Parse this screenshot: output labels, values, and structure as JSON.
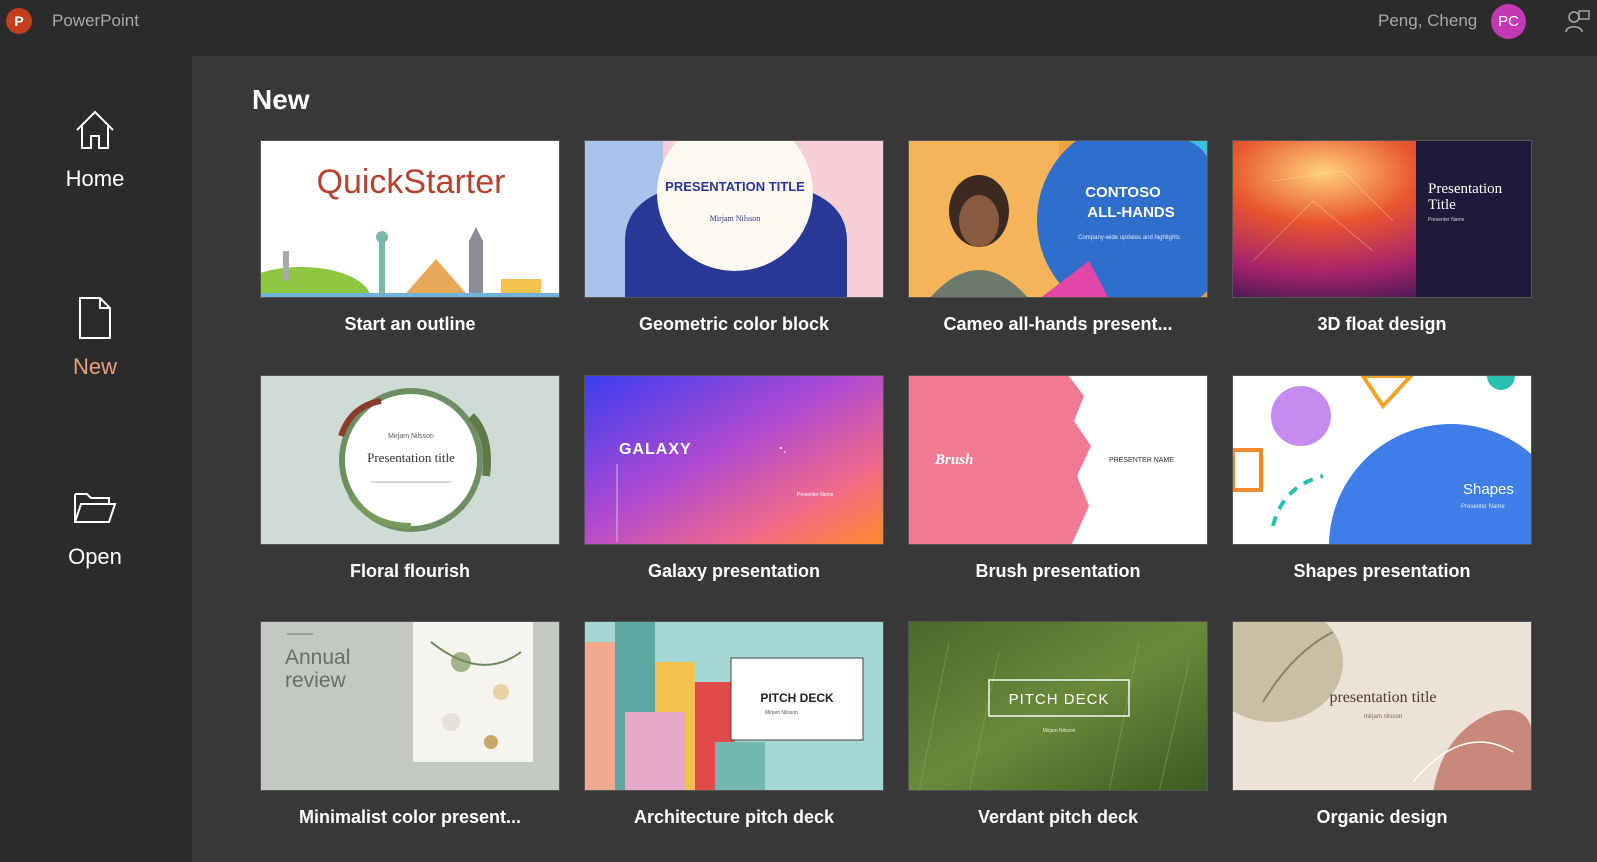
{
  "app": {
    "name": "PowerPoint",
    "icon_letter": "P"
  },
  "user": {
    "name": "Peng, Cheng",
    "initials": "PC"
  },
  "nav": [
    {
      "label": "Home",
      "icon": "home-icon"
    },
    {
      "label": "New",
      "icon": "new-document-icon",
      "active": true
    },
    {
      "label": "Open",
      "icon": "folder-open-icon"
    }
  ],
  "page": {
    "title": "New"
  },
  "templates": [
    {
      "label": "Start an outline",
      "thumb_text": "QuickStarter"
    },
    {
      "label": "Geometric color block",
      "thumb_text": "PRESENTATION TITLE",
      "thumb_sub": "Mirjam Nilsson"
    },
    {
      "label": "Cameo all-hands present...",
      "thumb_text": "CONTOSO ALL-HANDS",
      "thumb_sub": "Company-wide updates and highlights"
    },
    {
      "label": "3D float design",
      "thumb_text": "Presentation Title",
      "thumb_sub": "Presenter Name"
    },
    {
      "label": "Floral flourish",
      "thumb_text": "Presentation title",
      "thumb_sub": "Mirjam Nilsson"
    },
    {
      "label": "Galaxy presentation",
      "thumb_text": "GALAXY",
      "thumb_sub": "Presenter Name"
    },
    {
      "label": "Brush presentation",
      "thumb_text": "Brush",
      "thumb_sub": "PRESENTER NAME"
    },
    {
      "label": "Shapes presentation",
      "thumb_text": "Shapes",
      "thumb_sub": "Presenter Name"
    },
    {
      "label": "Minimalist color present...",
      "thumb_text": "Annual review"
    },
    {
      "label": "Architecture pitch deck",
      "thumb_text": "PITCH DECK",
      "thumb_sub": "Mirjam Nilsson"
    },
    {
      "label": "Verdant pitch deck",
      "thumb_text": "PITCH DECK",
      "thumb_sub": "Mirjam Nilsson"
    },
    {
      "label": "Organic design",
      "thumb_text": "presentation title",
      "thumb_sub": "mirjam nilsson"
    }
  ],
  "colors": {
    "accent": "#e8a07c",
    "avatar": "#c239b3",
    "app_icon": "#c43e1c",
    "sidebar_bg": "#2b2b2b",
    "main_bg": "#383838"
  }
}
